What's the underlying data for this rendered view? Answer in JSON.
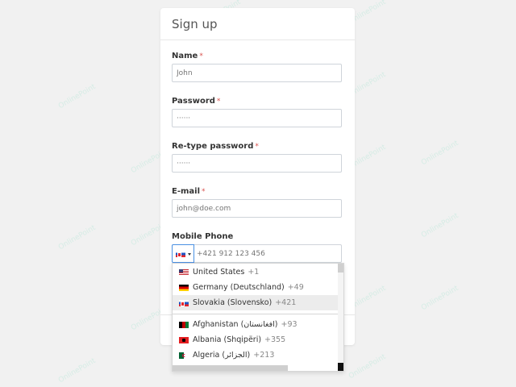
{
  "form": {
    "title": "Sign up",
    "required_mark": "*",
    "name": {
      "label": "Name",
      "placeholder": "John"
    },
    "password": {
      "label": "Password",
      "value": "······"
    },
    "retype_password": {
      "label": "Re-type password",
      "value": "······"
    },
    "email": {
      "label": "E-mail",
      "placeholder": "john@doe.com"
    },
    "mobile": {
      "label": "Mobile Phone",
      "placeholder": "+421 912 123 456",
      "selected_flag": "slovakia-flag-icon"
    }
  },
  "dropdown": {
    "preferred": [
      {
        "name": "United States",
        "code": "+1",
        "flag": "us-flag-icon"
      },
      {
        "name": "Germany (Deutschland)",
        "code": "+49",
        "flag": "germany-flag-icon"
      },
      {
        "name": "Slovakia (Slovensko)",
        "code": "+421",
        "flag": "slovakia-flag-icon",
        "highlighted": true
      }
    ],
    "countries": [
      {
        "name": "Afghanistan (‫افغانستان‬‎)",
        "code": "+93",
        "flag": "afghanistan-flag-icon"
      },
      {
        "name": "Albania (Shqipëri)",
        "code": "+355",
        "flag": "albania-flag-icon"
      },
      {
        "name": "Algeria (‫الجزائر‬‎)",
        "code": "+213",
        "flag": "algeria-flag-icon"
      }
    ]
  },
  "watermark": "OnlinePoint"
}
